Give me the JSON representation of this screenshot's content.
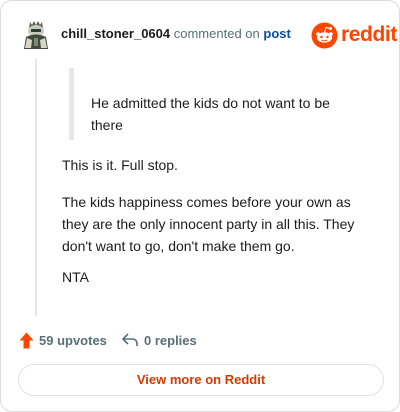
{
  "header": {
    "username": "chill_stoner_0604",
    "action_text": "commented on",
    "post_link": "post",
    "brand": "reddit",
    "avatar_icon": "snoo-avatar-icon",
    "brand_icon": "reddit-logo-icon"
  },
  "comment": {
    "quote": "He admitted the kids do not want to be there",
    "paragraphs": [
      "This is it. Full stop.",
      "The kids happiness comes before your own as they are the only innocent party in all this. They don't want to go, don't make them go.",
      "NTA"
    ]
  },
  "actions": {
    "upvotes": "59 upvotes",
    "replies": "0 replies",
    "upvote_icon": "upvote-arrow-icon",
    "reply_icon": "reply-arrow-icon"
  },
  "footer": {
    "view_more": "View more on Reddit"
  },
  "colors": {
    "brand": "#ff4500",
    "link": "#0a4ea3",
    "muted": "#576f76",
    "cta": "#d23c00"
  }
}
